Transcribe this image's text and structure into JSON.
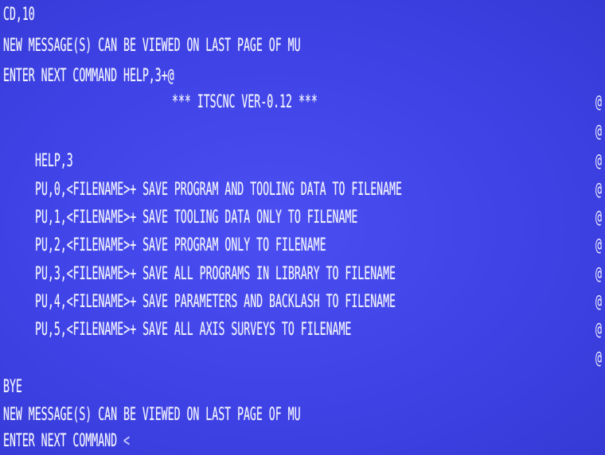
{
  "screen": {
    "bg_color": "#3f43e6",
    "text_color": "#f3f4ff"
  },
  "terminal": {
    "line_01": "CD,10",
    "line_02": "NEW MESSAGE(S) CAN BE VIEWED ON LAST PAGE OF MU",
    "line_03": "ENTER NEXT COMMAND HELP,3+@",
    "banner": "*** ITSCNC VER-0.12 ***",
    "help_cmd": "HELP,3",
    "help_items": [
      "PU,0,<FILENAME>+ SAVE PROGRAM AND TOOLING DATA TO FILENAME",
      "PU,1,<FILENAME>+ SAVE TOOLING DATA ONLY TO FILENAME",
      "PU,2,<FILENAME>+ SAVE PROGRAM ONLY TO FILENAME",
      "PU,3,<FILENAME>+ SAVE ALL PROGRAMS IN LIBRARY TO FILENAME",
      "PU,4,<FILENAME>+ SAVE PARAMETERS AND BACKLASH TO FILENAME",
      "PU,5,<FILENAME>+ SAVE ALL AXIS SURVEYS TO FILENAME"
    ],
    "right_marker": "@",
    "bye": "BYE",
    "line_msg2": "NEW MESSAGE(S) CAN BE VIEWED ON LAST PAGE OF MU",
    "prompt": "ENTER NEXT COMMAND",
    "cursor_char": "<"
  }
}
